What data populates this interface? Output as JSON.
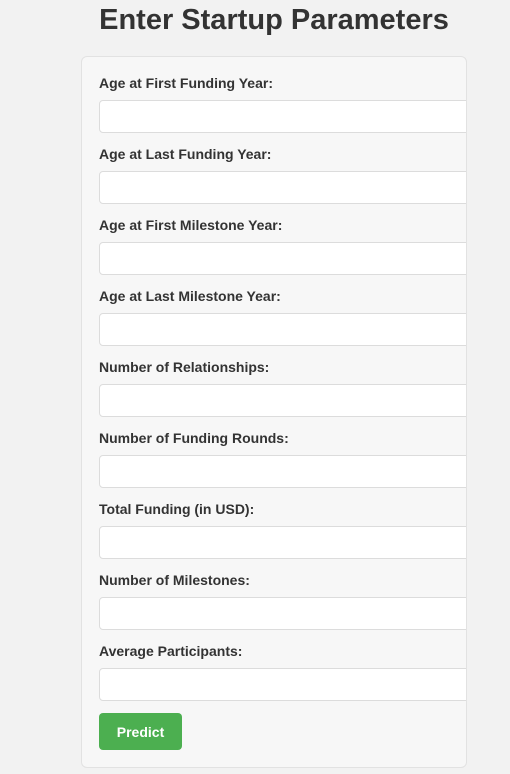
{
  "page": {
    "title": "Enter Startup Parameters"
  },
  "form": {
    "fields": [
      {
        "label": "Age at First Funding Year:",
        "value": "",
        "placeholder": ""
      },
      {
        "label": "Age at Last Funding Year:",
        "value": "",
        "placeholder": ""
      },
      {
        "label": "Age at First Milestone Year:",
        "value": "",
        "placeholder": ""
      },
      {
        "label": "Age at Last Milestone Year:",
        "value": "",
        "placeholder": ""
      },
      {
        "label": "Number of Relationships:",
        "value": "",
        "placeholder": ""
      },
      {
        "label": "Number of Funding Rounds:",
        "value": "",
        "placeholder": ""
      },
      {
        "label": "Total Funding (in USD):",
        "value": "",
        "placeholder": ""
      },
      {
        "label": "Number of Milestones:",
        "value": "",
        "placeholder": ""
      },
      {
        "label": "Average Participants:",
        "value": "",
        "placeholder": ""
      }
    ],
    "submit_label": "Predict"
  },
  "colors": {
    "background": "#f2f2f2",
    "card": "#f7f7f7",
    "title_text": "#333333",
    "button": "#4caf50",
    "button_text": "#ffffff"
  }
}
